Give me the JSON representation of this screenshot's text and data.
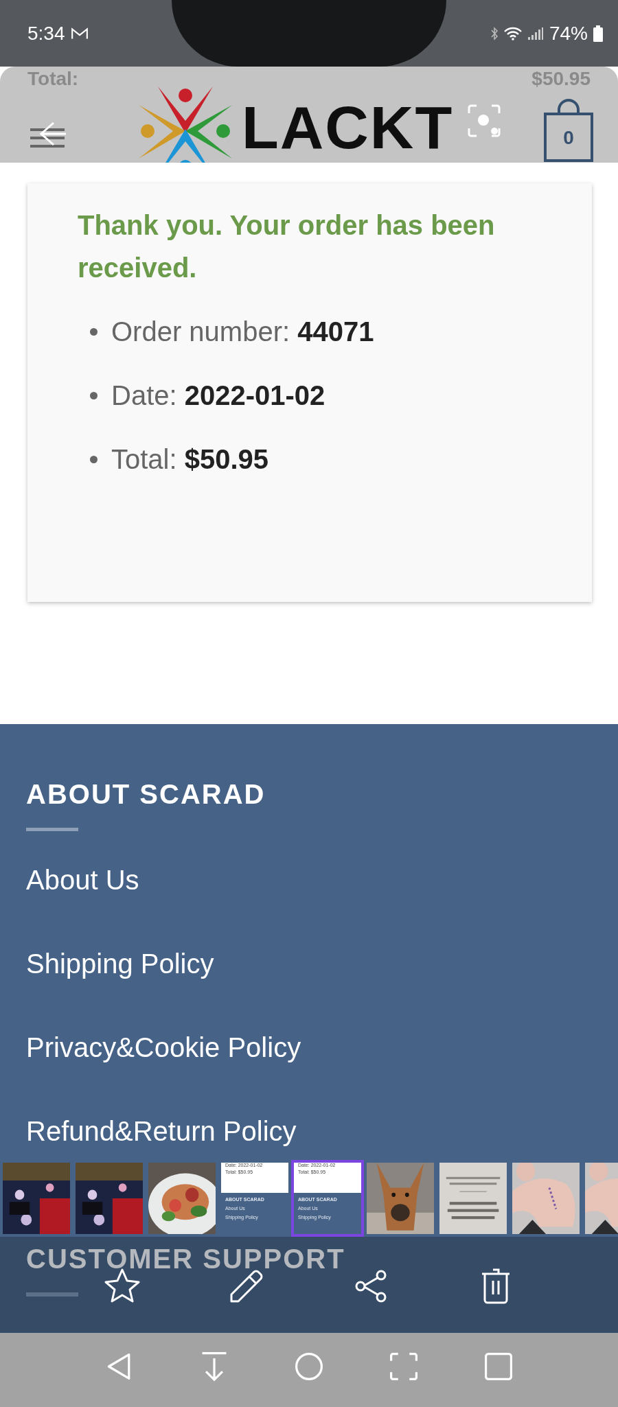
{
  "status_bar": {
    "time": "5:34",
    "battery": "74%"
  },
  "header": {
    "behind_text": [
      "Total:",
      "$50.95"
    ],
    "logo_text": "LACKT",
    "cart_count": "0"
  },
  "order": {
    "message": "Thank you. Your order has been received.",
    "details": [
      {
        "label": "Order number:",
        "value": "44071"
      },
      {
        "label": "Date:",
        "value": "2022-01-02"
      },
      {
        "label": "Total:",
        "value": "$50.95"
      }
    ]
  },
  "footer": {
    "sections": [
      {
        "title": "ABOUT SCARAD",
        "links": [
          "About Us",
          "Shipping Policy",
          "Privacy&Cookie Policy",
          "Refund&Return Policy"
        ]
      },
      {
        "title": "CUSTOMER SUPPORT"
      }
    ]
  },
  "filmstrip": [
    {
      "kind": "picture",
      "selected": false
    },
    {
      "kind": "picture",
      "selected": false
    },
    {
      "kind": "picture",
      "selected": false
    },
    {
      "kind": "screenshot",
      "selected": false,
      "lines": [
        "Date: 2022-01-02",
        "Total: $50.95"
      ],
      "title": "ABOUT SCARAD",
      "links": [
        "About Us",
        "Shipping Policy"
      ]
    },
    {
      "kind": "screenshot",
      "selected": true,
      "lines": [
        "Date: 2022-01-02",
        "Total: $50.95"
      ],
      "title": "ABOUT SCARAD",
      "links": [
        "About Us",
        "Shipping Policy"
      ]
    },
    {
      "kind": "picture",
      "selected": false
    },
    {
      "kind": "picture",
      "selected": false
    },
    {
      "kind": "picture",
      "selected": false
    },
    {
      "kind": "picture",
      "selected": false
    }
  ]
}
